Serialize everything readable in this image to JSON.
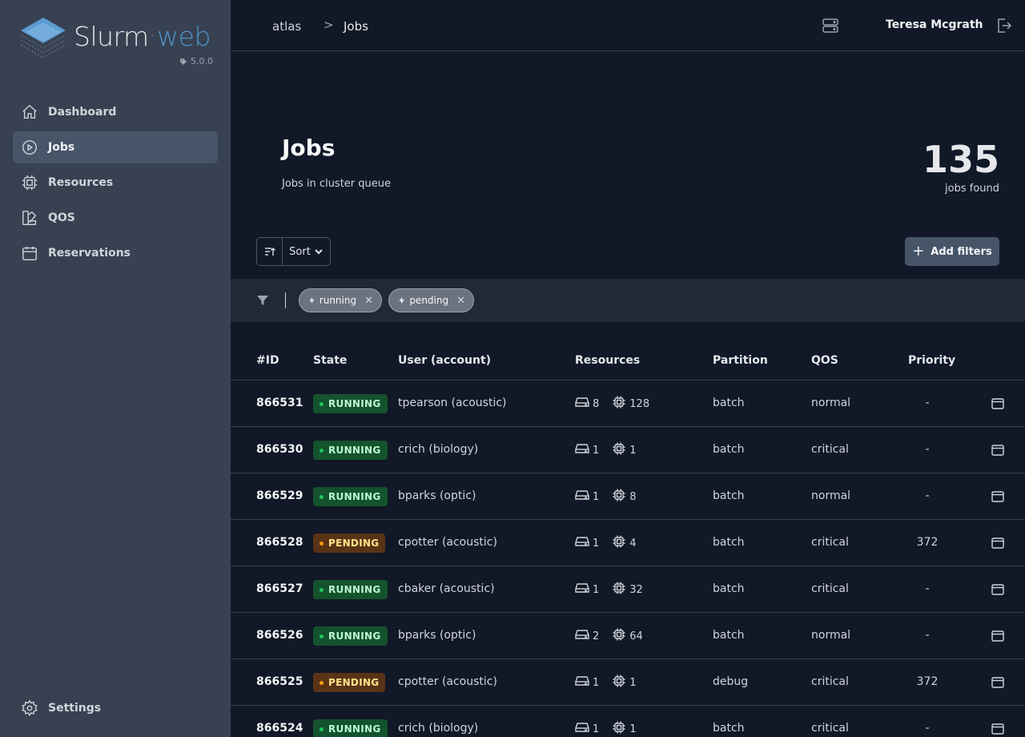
{
  "app": {
    "logo_text_main": "Slurm",
    "logo_text_dot": "·",
    "logo_text_accent": "web",
    "version": "5.0.0"
  },
  "sidebar": {
    "items": [
      {
        "label": "Dashboard",
        "icon": "home-icon",
        "active": false
      },
      {
        "label": "Jobs",
        "icon": "play-circle-icon",
        "active": true
      },
      {
        "label": "Resources",
        "icon": "cpu-chip-icon",
        "active": false
      },
      {
        "label": "QOS",
        "icon": "swatch-icon",
        "active": false
      },
      {
        "label": "Reservations",
        "icon": "calendar-icon",
        "active": false
      }
    ],
    "settings_label": "Settings"
  },
  "header": {
    "cluster": "atlas",
    "separator": ">",
    "page": "Jobs",
    "user": "Teresa Mcgrath"
  },
  "page": {
    "title": "Jobs",
    "subtitle": "Jobs in cluster queue",
    "count": "135",
    "count_label": "jobs found"
  },
  "toolbar": {
    "sort_label": "Sort",
    "add_filters_label": "Add filters"
  },
  "filters": {
    "chips": [
      "running",
      "pending"
    ]
  },
  "table": {
    "headers": [
      "#ID",
      "State",
      "User (account)",
      "Resources",
      "Partition",
      "QOS",
      "Priority"
    ],
    "rows": [
      {
        "id": "866531",
        "state": "RUNNING",
        "user": "tpearson (acoustic)",
        "nodes": "8",
        "cpus": "128",
        "partition": "batch",
        "qos": "normal",
        "priority": "-"
      },
      {
        "id": "866530",
        "state": "RUNNING",
        "user": "crich (biology)",
        "nodes": "1",
        "cpus": "1",
        "partition": "batch",
        "qos": "critical",
        "priority": "-"
      },
      {
        "id": "866529",
        "state": "RUNNING",
        "user": "bparks (optic)",
        "nodes": "1",
        "cpus": "8",
        "partition": "batch",
        "qos": "normal",
        "priority": "-"
      },
      {
        "id": "866528",
        "state": "PENDING",
        "user": "cpotter (acoustic)",
        "nodes": "1",
        "cpus": "4",
        "partition": "batch",
        "qos": "critical",
        "priority": "372"
      },
      {
        "id": "866527",
        "state": "RUNNING",
        "user": "cbaker (acoustic)",
        "nodes": "1",
        "cpus": "32",
        "partition": "batch",
        "qos": "critical",
        "priority": "-"
      },
      {
        "id": "866526",
        "state": "RUNNING",
        "user": "bparks (optic)",
        "nodes": "2",
        "cpus": "64",
        "partition": "batch",
        "qos": "normal",
        "priority": "-"
      },
      {
        "id": "866525",
        "state": "PENDING",
        "user": "cpotter (acoustic)",
        "nodes": "1",
        "cpus": "1",
        "partition": "debug",
        "qos": "critical",
        "priority": "372"
      },
      {
        "id": "866524",
        "state": "RUNNING",
        "user": "crich (biology)",
        "nodes": "1",
        "cpus": "1",
        "partition": "batch",
        "qos": "critical",
        "priority": "-"
      }
    ]
  },
  "colors": {
    "sidebar_bg": "#374151",
    "main_bg": "#111827",
    "running_badge": "#14532d",
    "pending_badge": "#5a3317",
    "accent": "#4d8fc4"
  }
}
